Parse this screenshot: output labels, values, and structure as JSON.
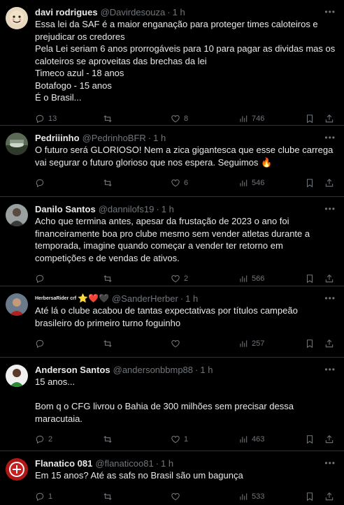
{
  "tweets": [
    {
      "name": "davi rodrigues",
      "handle": "@Davirdesouza",
      "time": "1 h",
      "text": "Essa lei da SAF é a maior enganação para proteger times caloteiros e prejudicar os credores\nPela Lei seriam 6 anos prorrogáveis para 10 para pagar as dividas mas os caloteiros se aproveitas das brechas da lei\nTimeco azul - 18 anos\nBotafogo - 15 anos\nÉ o  Brasil...",
      "replies": "13",
      "retweets": "",
      "likes": "8",
      "views": "746"
    },
    {
      "name": "Pedriiinho",
      "handle": "@PedrinhoBFR",
      "time": "1 h",
      "text": "O futuro será GLORIOSO! Nem a zica gigantesca que esse clube carrega vai segurar o futuro glorioso que nos espera. Seguimos 🔥",
      "replies": "",
      "retweets": "",
      "likes": "6",
      "views": "546"
    },
    {
      "name": "Danilo Santos",
      "handle": "@dannilofs19",
      "time": "1 h",
      "text": "Acho que termina antes, apesar da frustação de 2023 o ano foi financeiramente boa pro clube mesmo sem vender atletas durante a temporada, imagine quando começar a vender ter retorno em competições e de vendas de ativos.",
      "replies": "",
      "retweets": "",
      "likes": "2",
      "views": "566"
    },
    {
      "name": "HerbersaRider crf",
      "handle": "@SanderHerber",
      "time": "1 h",
      "emojis": "⭐❤️🖤",
      "text": "Até lá o clube acabou de tantas expectativas por títulos campeão brasileiro do primeiro turno foguinho",
      "replies": "",
      "retweets": "",
      "likes": "",
      "views": "257"
    },
    {
      "name": "Anderson Santos",
      "handle": "@andersonbbmp88",
      "time": "1 h",
      "text": "15 anos...\n\nBom q o CFG livrou o Bahia de 300 milhões sem precisar dessa maracutaia.",
      "replies": "2",
      "retweets": "",
      "likes": "1",
      "views": "463"
    },
    {
      "name": "Flanatico 081",
      "handle": "@flanaticoo81",
      "time": "1 h",
      "text": "Em 15 anos? Até as safs no Brasil são um bagunça",
      "replies": "1",
      "retweets": "",
      "likes": "",
      "views": "533"
    }
  ],
  "colors": {
    "background": "#000000",
    "text": "#e7e9ea",
    "secondary": "#71767b",
    "divider": "#2f3336"
  }
}
